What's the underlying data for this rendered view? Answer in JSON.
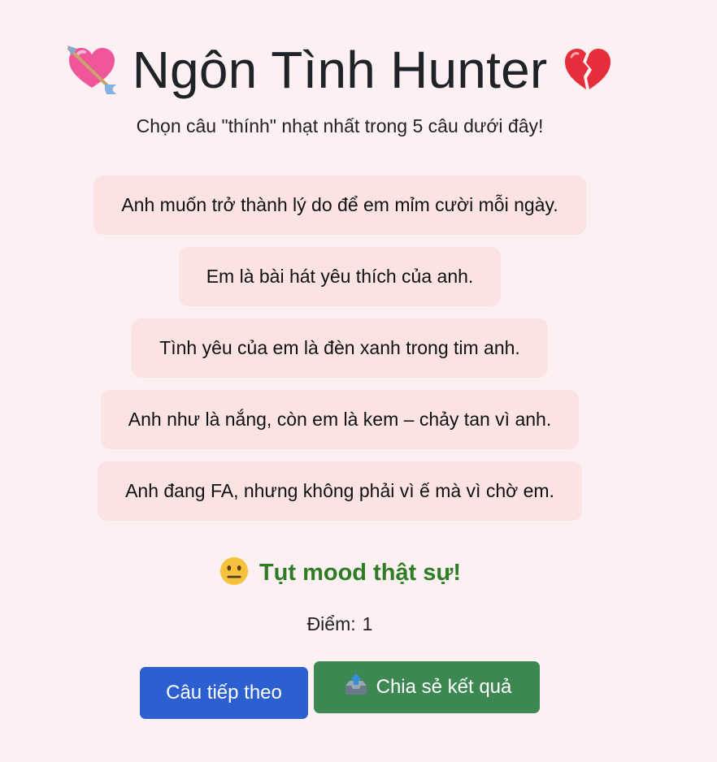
{
  "header": {
    "title": "Ngôn Tình Hunter",
    "left_icon": "heart-with-arrow-icon",
    "right_icon": "broken-heart-icon",
    "subtitle": "Chọn câu \"thính\" nhạt nhất trong 5 câu dưới đây!"
  },
  "options": [
    {
      "label": "Anh muốn trở thành lý do để em mỉm cười mỗi ngày."
    },
    {
      "label": "Em là bài hát yêu thích của anh."
    },
    {
      "label": "Tình yêu của em là đèn xanh trong tim anh."
    },
    {
      "label": "Anh như là nắng, còn em là kem – chảy tan vì anh."
    },
    {
      "label": "Anh đang FA, nhưng không phải vì ế mà vì chờ em."
    }
  ],
  "result": {
    "icon": "neutral-face-icon",
    "text": "Tụt mood thật sự!",
    "color": "#2e7d24"
  },
  "score": {
    "label": "Điểm:",
    "value": "1"
  },
  "buttons": {
    "next_label": "Câu tiếp theo",
    "share_label": "Chia sẻ kết quả",
    "share_icon": "outbox-tray-icon"
  },
  "colors": {
    "background": "#fdf0f3",
    "option_bg": "#fae3e2",
    "next_button": "#2c5fd0",
    "share_button": "#3d8753"
  }
}
